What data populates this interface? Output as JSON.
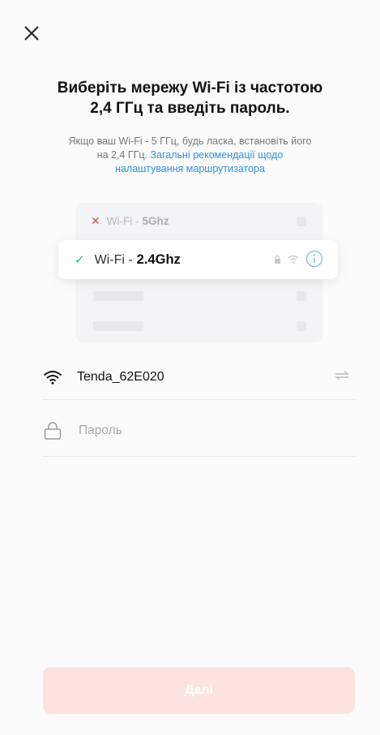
{
  "header": {
    "title_line1": "Виберіть мережу Wi-Fi із частотою",
    "title_line2": "2,4 ГГц та введіть пароль."
  },
  "hint": {
    "text_line1": "Якщо ваш Wi-Fi - 5 ГГц, будь ласка, встановіть його",
    "text_line2_prefix": "на 2,4 ГГц. ",
    "link_part1": "Загальні рекомендації щодо",
    "link_part2": "налаштування маршрутизатора"
  },
  "illustration": {
    "bad_prefix": "Wi-Fi -",
    "bad_band": "5Ghz",
    "good_prefix": "Wi-Fi -",
    "good_band": "2.4Ghz"
  },
  "network": {
    "ssid": "Tenda_62E020"
  },
  "password": {
    "placeholder": "Пароль",
    "value": ""
  },
  "footer": {
    "next_label": "Далі"
  },
  "colors": {
    "accent_check": "#21b38c",
    "cross": "#e34b4b",
    "link": "#2f8fe0",
    "button_disabled": "#fde3df"
  }
}
